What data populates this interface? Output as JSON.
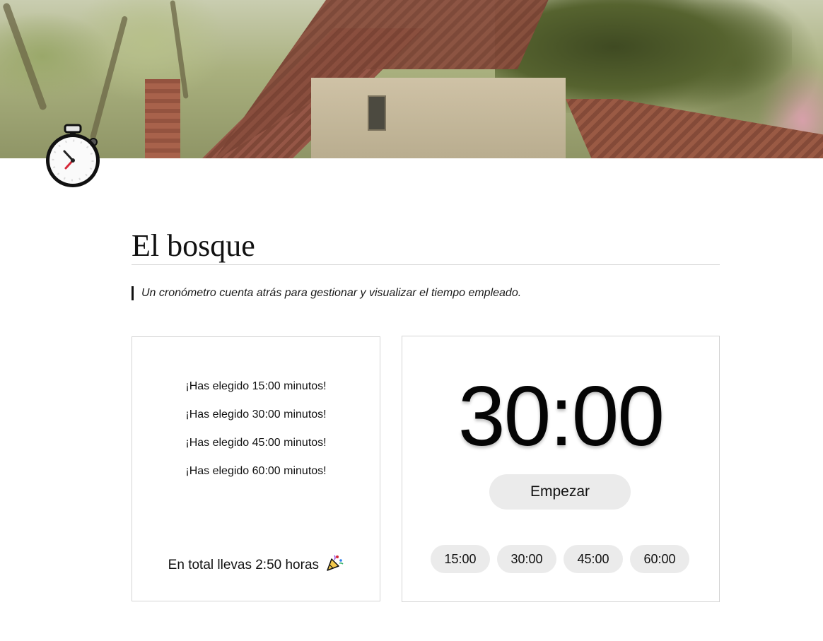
{
  "page": {
    "title": "El bosque",
    "description": "Un cronómetro cuenta atrás para gestionar y visualizar el tiempo empleado."
  },
  "icons": {
    "page_icon": "stopwatch-icon",
    "total_emoji": "party-popper-icon"
  },
  "history": {
    "lines": [
      "¡Has elegido 15:00 minutos!",
      "¡Has elegido 30:00 minutos!",
      "¡Has elegido 45:00 minutos!",
      "¡Has elegido 60:00 minutos!"
    ],
    "total_text": "En total llevas 2:50 horas"
  },
  "timer": {
    "display": "30:00",
    "start_label": "Empezar",
    "presets": [
      "15:00",
      "30:00",
      "45:00",
      "60:00"
    ]
  },
  "colors": {
    "button_bg": "#ebebeb",
    "border": "#d4d4d4",
    "text": "#111111",
    "stopwatch_hand": "#d62839"
  }
}
